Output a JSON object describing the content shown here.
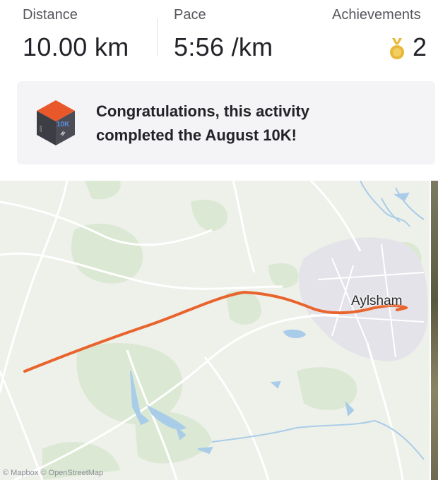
{
  "stats": {
    "distance": {
      "label": "Distance",
      "value": "10.00 km"
    },
    "pace": {
      "label": "Pace",
      "value": "5:56 /km"
    },
    "achievements": {
      "label": "Achievements",
      "value": "2",
      "icon": "medal-icon"
    }
  },
  "banner": {
    "line1": "Congratulations, this activity",
    "line2": "completed the August 10K!",
    "badge_text": "10K",
    "badge_side_text": "2023"
  },
  "map": {
    "town": "Aylsham",
    "attribution": "© Mapbox © OpenStreetMap",
    "route_color": "#e8642c"
  }
}
